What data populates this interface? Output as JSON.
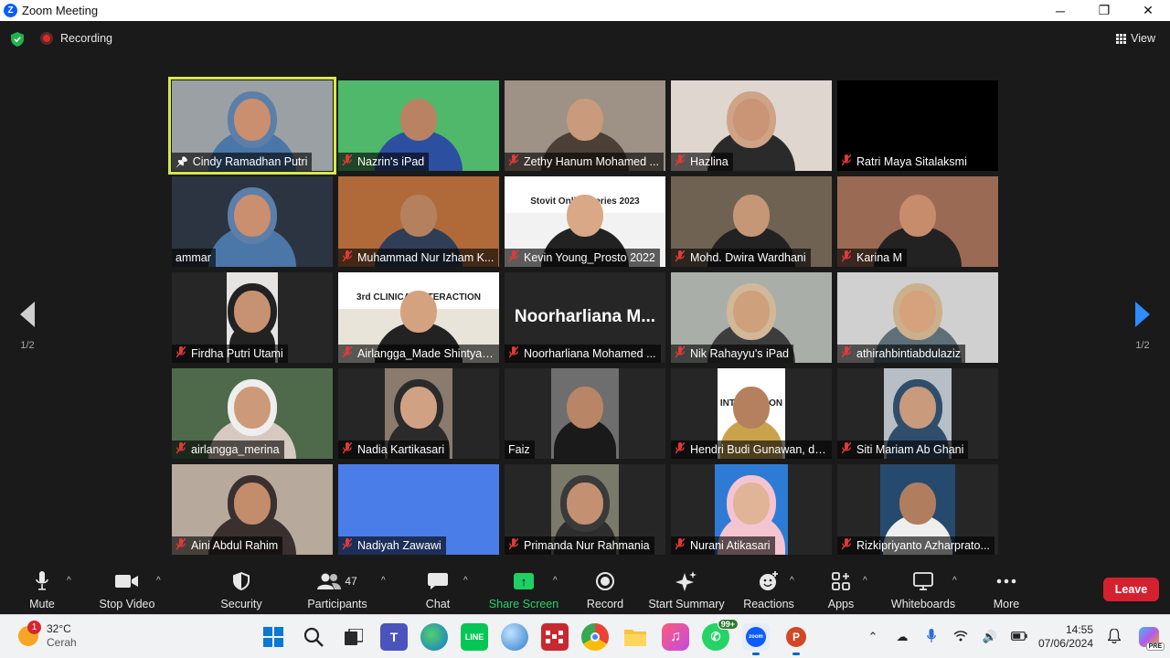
{
  "window": {
    "title": "Zoom Meeting",
    "logo_letter": "Z",
    "minimize": "─",
    "maximize": "❐",
    "close": "✕"
  },
  "topbar": {
    "recording_label": "Recording",
    "view_label": "View"
  },
  "pagination": {
    "left_page": "1/2",
    "right_page": "1/2"
  },
  "participants": [
    {
      "name": "Cindy Ramadhan Putri",
      "mic": "pinned",
      "active": true,
      "bg": "#9aa0a4",
      "skin": "#c98f6e",
      "cloth": "#4a77a8",
      "hijab": "#5b7fa8"
    },
    {
      "name": "Nazrin's iPad",
      "mic": "muted",
      "bg": "#4fb86b",
      "skin": "#b98263",
      "cloth": "#2d4fa0"
    },
    {
      "name": "Zethy Hanum Mohamed ...",
      "mic": "muted",
      "bg": "#9d9285",
      "skin": "#c99a7b",
      "cloth": "#4c4036"
    },
    {
      "name": "Hazlina",
      "mic": "muted",
      "bg": "#dfd7cf",
      "skin": "#c99576",
      "cloth": "#2a2a2a",
      "hijab": "#cfa486"
    },
    {
      "name": "Ratri Maya Sitalaksmi",
      "mic": "muted",
      "bg": "#000000",
      "skin": "",
      "cloth": ""
    },
    {
      "name": "ammar",
      "mic": "none",
      "bg": "#2b3440",
      "skin": "#c98f6e",
      "cloth": "#4a77a8",
      "hijab": "#5b7fa8"
    },
    {
      "name": "Muhammad Nur Izham K...",
      "mic": "muted",
      "bg": "#b06a3a",
      "skin": "#b5805e",
      "cloth": "#2f3d56"
    },
    {
      "name": "Kevin Young_Prosto 2022",
      "mic": "muted",
      "bg": "#f2f2f2",
      "skin": "#d8a887",
      "cloth": "#222222",
      "slide": "Stovit Online Series 2023"
    },
    {
      "name": "Mohd. Dwira Wardhani",
      "mic": "muted",
      "bg": "#6f6253",
      "skin": "#c59777",
      "cloth": "#222222"
    },
    {
      "name": "Karina M",
      "mic": "muted",
      "bg": "#9a6a55",
      "skin": "#c68c6b",
      "cloth": "#222222"
    },
    {
      "name": "Firdha Putri Utami",
      "mic": "muted",
      "bg": "#e6e3e3",
      "skin": "#c79271",
      "cloth": "#222222",
      "hijab": "#222222"
    },
    {
      "name": "Airlangga_Made Shintya ...",
      "mic": "muted",
      "bg": "#e8e4da",
      "skin": "#d5a27f",
      "cloth": "#222222",
      "slide": "3rd CLINICAL INTERACTION"
    },
    {
      "name": "Noorharliana Mohamed ...",
      "mic": "muted",
      "bg": "#262626",
      "skin": "",
      "cloth": "",
      "bigname": "Noorharliana M..."
    },
    {
      "name": "Nik Rahayyu's iPad",
      "mic": "muted",
      "bg": "#a9aea8",
      "skin": "#cfa07c",
      "cloth": "#3d3d3d",
      "hijab": "#d0b899"
    },
    {
      "name": "athirahbintiabdulaziz",
      "mic": "muted",
      "bg": "#cfd0cf",
      "skin": "#d6a27e",
      "cloth": "#5e6f78",
      "hijab": "#cbb08c"
    },
    {
      "name": "airlangga_merina",
      "mic": "muted",
      "bg": "#4e6a4a",
      "skin": "#cd9a79",
      "cloth": "#d8c9c0",
      "hijab": "#eeeeee"
    },
    {
      "name": "Nadia Kartikasari",
      "mic": "muted",
      "bg": "#8b7a6e",
      "skin": "#d1a183",
      "cloth": "#2b2b2b",
      "hijab": "#2b2b2b"
    },
    {
      "name": "Faiz",
      "mic": "none",
      "bg": "#6e6e6e",
      "skin": "#b88566",
      "cloth": "#1a1a1a"
    },
    {
      "name": "Hendri Budi Gunawan, drg.",
      "mic": "muted",
      "bg": "#ffffff",
      "skin": "#b5805e",
      "cloth": "#caa24b",
      "slide": "L INTERACTION"
    },
    {
      "name": "Siti Mariam Ab Ghani",
      "mic": "muted",
      "bg": "#b8bec6",
      "skin": "#c99a7b",
      "cloth": "#2f4e6b",
      "hijab": "#2f4e6b"
    },
    {
      "name": "Aini Abdul Rahim",
      "mic": "muted",
      "bg": "#b7a99b",
      "skin": "#c38c6b",
      "cloth": "#3a3030",
      "hijab": "#3a3030"
    },
    {
      "name": "Nadiyah Zawawi",
      "mic": "muted",
      "bg": "#4a7de8",
      "skin": "",
      "cloth": ""
    },
    {
      "name": "Primanda Nur Rahmania",
      "mic": "muted",
      "bg": "#7a7a6a",
      "skin": "#c39171",
      "cloth": "#2e2e2e",
      "hijab": "#3a3a3a"
    },
    {
      "name": "Nurani Atikasari",
      "mic": "muted",
      "bg": "#2e7bd6",
      "skin": "#e0b497",
      "cloth": "#f4c4d0",
      "hijab": "#f4c4d0"
    },
    {
      "name": "Rizkipriyanto Azharprato...",
      "mic": "muted",
      "bg": "#264a6e",
      "skin": "#b07e5e",
      "cloth": "#eeeeee"
    }
  ],
  "toolbar": {
    "mute": "Mute",
    "stop_video": "Stop Video",
    "security": "Security",
    "participants": "Participants",
    "participants_count": "47",
    "chat": "Chat",
    "share_screen": "Share Screen",
    "record": "Record",
    "start_summary": "Start Summary",
    "reactions": "Reactions",
    "apps": "Apps",
    "whiteboards": "Whiteboards",
    "more": "More",
    "leave": "Leave"
  },
  "taskbar": {
    "weather_temp": "32°C",
    "weather_cond": "Cerah",
    "weather_badge": "1",
    "whatsapp_badge": "99+",
    "time": "14:55",
    "date": "07/06/2024",
    "copilot_badge": "PRE",
    "apps": [
      "windows-start",
      "search",
      "task-view",
      "teams",
      "edge",
      "line",
      "globe",
      "app-mosaic",
      "chrome",
      "file-explorer",
      "itunes",
      "whatsapp",
      "zoom",
      "powerpoint"
    ]
  },
  "colors": {
    "accent_blue": "#2d8cff",
    "share_green": "#1fcf62",
    "leave_red": "#d4212f",
    "active_speaker": "#d6e84a",
    "muted_red": "#e03a3a"
  }
}
